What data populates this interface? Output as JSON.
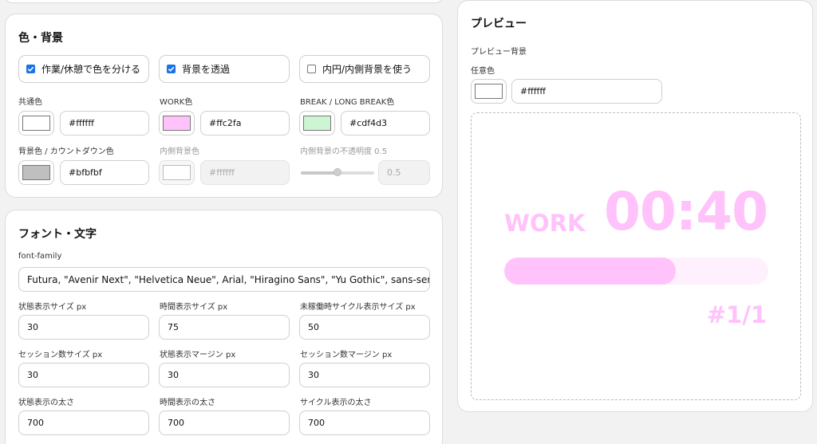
{
  "color_section": {
    "title": "色・背景",
    "checkboxes": [
      {
        "label": "作業/休憩で色を分ける",
        "checked": true
      },
      {
        "label": "背景を透過",
        "checked": true
      },
      {
        "label": "内円/内側背景を使う",
        "checked": false
      }
    ],
    "fields": {
      "common": {
        "label": "共通色",
        "value": "#ffffff"
      },
      "work": {
        "label": "WORK色",
        "value": "#ffc2fa"
      },
      "break": {
        "label": "BREAK / LONG BREAK色",
        "value": "#cdf4d3"
      },
      "bg_countdown": {
        "label": "背景色 / カウントダウン色",
        "value": "#bfbfbf"
      },
      "inner_bg": {
        "label": "内側背景色",
        "value": "#ffffff"
      },
      "inner_opacity": {
        "label": "内側背景の不透明度 0.5",
        "value": "0.5",
        "slider_fraction": 0.5
      }
    }
  },
  "font_section": {
    "title": "フォント・文字",
    "font_family": {
      "label": "font-family",
      "value": "Futura, \"Avenir Next\", \"Helvetica Neue\", Arial, \"Hiragino Sans\", \"Yu Gothic\", sans-serif"
    },
    "fields": [
      {
        "label": "状態表示サイズ px",
        "value": "30"
      },
      {
        "label": "時間表示サイズ px",
        "value": "75"
      },
      {
        "label": "未稼働時サイクル表示サイズ px",
        "value": "50"
      },
      {
        "label": "セッション数サイズ px",
        "value": "30"
      },
      {
        "label": "状態表示マージン px",
        "value": "30"
      },
      {
        "label": "セッション数マージン px",
        "value": "30"
      },
      {
        "label": "状態表示の太さ",
        "value": "700"
      },
      {
        "label": "時間表示の太さ",
        "value": "700"
      },
      {
        "label": "サイクル表示の太さ",
        "value": "700"
      }
    ]
  },
  "preview": {
    "title": "プレビュー",
    "bg_label": "プレビュー背景",
    "custom_color_label": "任意色",
    "bg_value": "#ffffff",
    "status": "WORK",
    "time": "00:40",
    "progress": 0.65,
    "cycle": "#1/1"
  },
  "colors": {
    "common": "#ffffff",
    "work": "#ffc2fa",
    "break": "#cdf4d3",
    "bg_countdown": "#bfbfbf",
    "inner_bg": "#ffffff",
    "accent": "#1a73e8"
  }
}
